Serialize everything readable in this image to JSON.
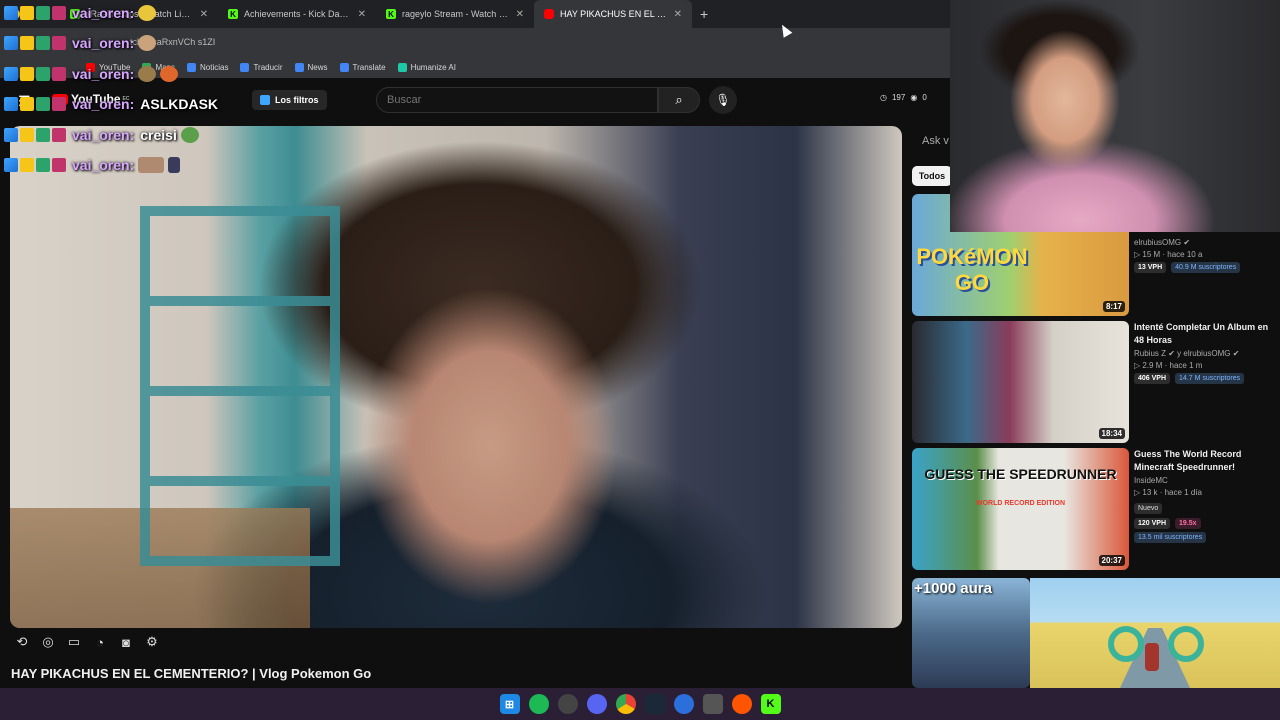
{
  "browser": {
    "tabs": [
      {
        "title": "",
        "icon": "emoji-icon",
        "active": false
      },
      {
        "title": "xRaaiin Clips - Watch Live on K",
        "icon": "kick-icon",
        "active": false
      },
      {
        "title": "Achievements - Kick Dashboard",
        "icon": "kick-icon",
        "active": false
      },
      {
        "title": "rageylo Stream - Watch Live on",
        "icon": "kick-icon",
        "active": false
      },
      {
        "title": "HAY PIKACHUS EN EL CEMENTE",
        "icon": "youtube-icon",
        "active": true
      }
    ],
    "address_partial": "tch?v=aRxnVCh s1ZI",
    "bookmarks": [
      {
        "label": "YouTube",
        "color": "#ff0000"
      },
      {
        "label": "Maps",
        "color": "#34a853"
      },
      {
        "label": "Noticias",
        "color": "#4285f4"
      },
      {
        "label": "Traducir",
        "color": "#4285f4"
      },
      {
        "label": "News",
        "color": "#4285f4"
      },
      {
        "label": "Translate",
        "color": "#4285f4"
      },
      {
        "label": "Humanize AI",
        "color": "#1ec9a8"
      }
    ]
  },
  "header": {
    "logo_text": "YouTube",
    "logo_region": "EC",
    "filters_label": "Los filtros",
    "search_placeholder": "Buscar",
    "stats": {
      "views": "197",
      "a": "0"
    }
  },
  "chat": {
    "lines": [
      {
        "user": "vai_oren:",
        "msg": ""
      },
      {
        "user": "vai_oren:",
        "msg": ""
      },
      {
        "user": "vai_oren:",
        "msg": ""
      },
      {
        "user": "vai_oren:",
        "msg": "ASLKDASK"
      },
      {
        "user": "vai_oren:",
        "msg": "creisi"
      },
      {
        "user": "vai_oren:",
        "msg": ""
      }
    ]
  },
  "video": {
    "title": "HAY PIKACHUS EN EL CEMENTERIO? | Vlog Pokemon Go"
  },
  "sidebar": {
    "ask_label": "Ask v",
    "chip_label": "Todos",
    "recommendations": [
      {
        "title": "",
        "channel": "elrubiusOMG",
        "views": "15 M",
        "age": "hace 10 a",
        "vph": "13 VPH",
        "subs": "40.9 M suscriptores",
        "duration": "8:17",
        "thumb_text": "POKéMON GO"
      },
      {
        "title": "Intenté Completar Un Album en 48 Horas",
        "channel": "Rubius Z",
        "channel2": "y elrubiusOMG",
        "views": "2.9 M",
        "age": "hace 1 m",
        "vph": "406 VPH",
        "subs": "14.7 M suscriptores",
        "duration": "18:34",
        "thumb_text": ""
      },
      {
        "title": "Guess The World Record Minecraft Speedrunner!",
        "channel": "InsideMC",
        "views": "13 k",
        "age": "hace 1 día",
        "badge": "Nuevo",
        "vph": "120 VPH",
        "multiplier": "19.5x",
        "subs": "13.5 mil suscriptores",
        "duration": "20:37",
        "thumb_text": "GUESS THE SPEEDRUNNER",
        "thumb_sub": "WORLD RECORD EDITION"
      },
      {
        "title": "",
        "thumb_text": "+1000 aura"
      }
    ]
  }
}
